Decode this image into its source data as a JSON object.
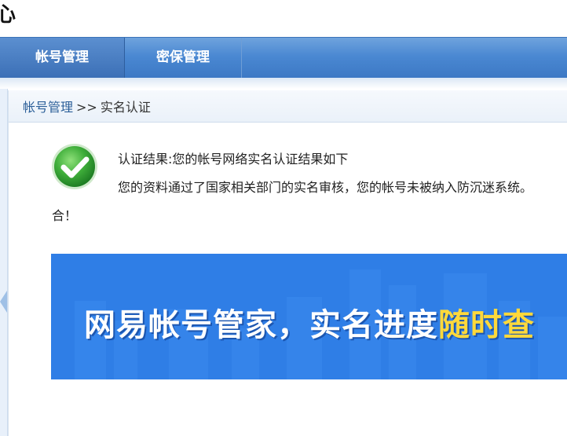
{
  "header": {
    "title": "心"
  },
  "nav": {
    "tabs": [
      {
        "label": "帐号管理",
        "active": true
      },
      {
        "label": "密保管理",
        "active": false
      }
    ]
  },
  "breadcrumb": {
    "parent": "帐号管理",
    "separator": ">>",
    "current": "实名认证"
  },
  "result": {
    "title": "认证结果:您的帐号网络实名认证结果如下",
    "description": "您的资料通过了国家相关部门的实名审核，您的帐号未被纳入防沉迷系统。",
    "description_end": "合！"
  },
  "banner": {
    "text_main": "网易帐号管家，实名进度",
    "text_highlight": "随时查",
    "highlight_color": "#ffd93b",
    "background_color": "#2f7ee6"
  },
  "colors": {
    "nav_bar": "#4a88d2",
    "success_green": "#3aa63a",
    "breadcrumb_link": "#2c5f99"
  },
  "icons": {
    "status": "check-circle-icon",
    "rail": "chevron-left-icon"
  }
}
